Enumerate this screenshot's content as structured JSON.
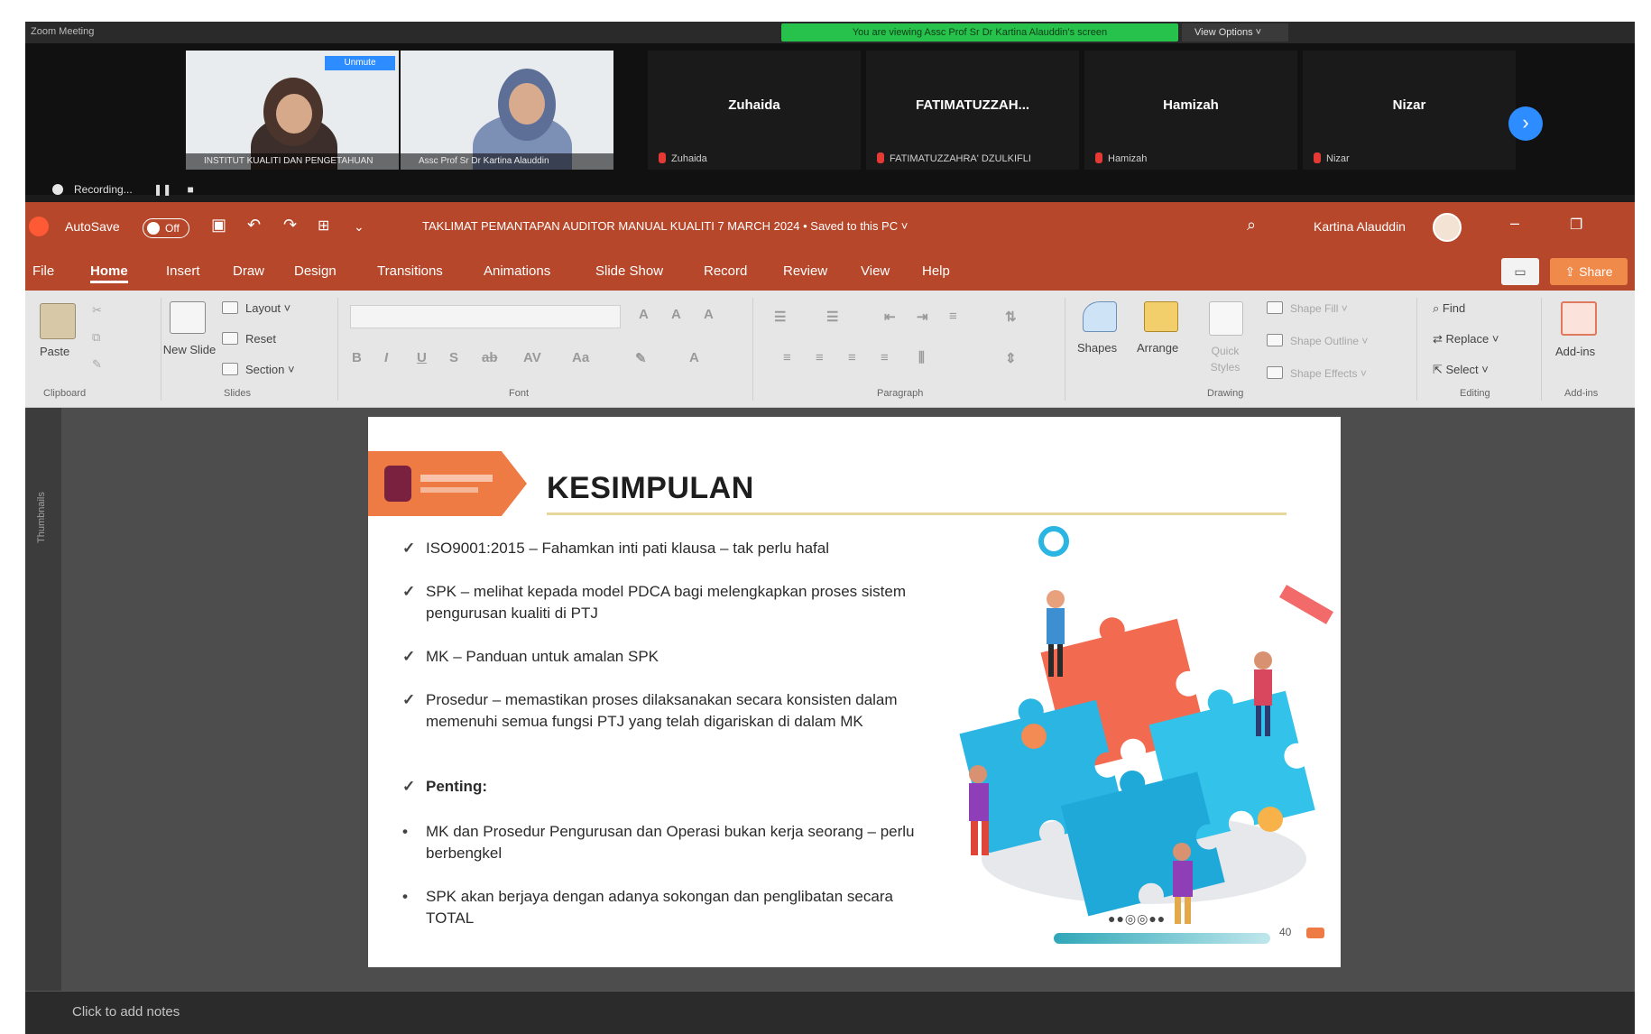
{
  "zoom": {
    "window_title": "Zoom Meeting",
    "viewing_banner": "You are viewing Assc Prof Sr Dr Kartina Alauddin's screen",
    "view_options": "View Options ˅",
    "participants_video": [
      {
        "name": "INSTITUT KUALITI DAN PENGETAHUAN",
        "badge": "Unmute"
      },
      {
        "name": "Assc Prof Sr Dr Kartina Alauddin"
      }
    ],
    "participants_name_tiles": [
      {
        "display": "Zuhaida",
        "footer": "Zuhaida"
      },
      {
        "display": "FATIMATUZZAH...",
        "footer": "FATIMATUZZAHRA' DZULKIFLI"
      },
      {
        "display": "Hamizah",
        "footer": "Hamizah"
      },
      {
        "display": "Nizar",
        "footer": "Nizar"
      }
    ],
    "recording": "Recording...",
    "recording_pause": "❚❚",
    "recording_stop": "■"
  },
  "ppt": {
    "autosave_label": "AutoSave",
    "autosave_state": "Off",
    "doc_title": "TAKLIMAT PEMANTAPAN AUDITOR MANUAL KUALITI 7 MARCH 2024 • Saved to this PC ˅",
    "user_name": "Kartina Alauddin",
    "tabs": [
      "File",
      "Home",
      "Insert",
      "Draw",
      "Design",
      "Transitions",
      "Animations",
      "Slide Show",
      "Record",
      "Review",
      "View",
      "Help"
    ],
    "share_label": "Share",
    "ribbon": {
      "paste": "Paste",
      "new_slide": "New Slide",
      "layout": "Layout ˅",
      "reset": "Reset",
      "section": "Section ˅",
      "shapes": "Shapes",
      "arrange": "Arrange",
      "quick_styles": "Quick Styles",
      "shape_fill": "Shape Fill ˅",
      "shape_outline": "Shape Outline ˅",
      "shape_effects": "Shape Effects ˅",
      "find": "Find",
      "replace": "Replace ˅",
      "select": "Select ˅",
      "add_ins": "Add-ins",
      "groups": [
        "Clipboard",
        "Slides",
        "Font",
        "Paragraph",
        "Drawing",
        "Editing",
        "Add-ins"
      ]
    },
    "thumbnails_label": "Thumbnails",
    "notes_placeholder": "Click to add notes"
  },
  "slide": {
    "title": "KESIMPULAN",
    "items": [
      {
        "marker": "✓",
        "text": "ISO9001:2015 – Fahamkan inti pati klausa – tak perlu hafal"
      },
      {
        "marker": "✓",
        "text": "SPK – melihat kepada model PDCA bagi melengkapkan proses sistem pengurusan kualiti di PTJ"
      },
      {
        "marker": "✓",
        "text": "MK – Panduan untuk amalan SPK"
      },
      {
        "marker": "✓",
        "text": "Prosedur – memastikan proses dilaksanakan secara konsisten dalam memenuhi semua fungsi PTJ yang telah digariskan di dalam MK"
      },
      {
        "marker": "✓",
        "text": "Penting:"
      },
      {
        "marker": "•",
        "text": "MK dan Prosedur Pengurusan dan Operasi bukan kerja seorang – perlu berbengkel"
      },
      {
        "marker": "•",
        "text": "SPK akan berjaya dengan adanya sokongan dan penglibatan secara TOTAL"
      }
    ],
    "slide_number": "40"
  },
  "colors": {
    "ppt_accent": "#b7472a",
    "zoom_banner": "#27c24c",
    "slide_logo_ribbon": "#ef7b44",
    "puzzle_blue": "#2bb5e3",
    "puzzle_orange": "#f26a4f"
  }
}
